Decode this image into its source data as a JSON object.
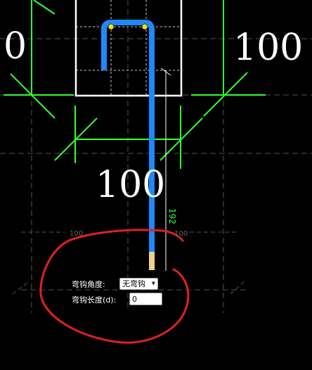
{
  "dimensions": {
    "left_value": "0",
    "right_value": "100",
    "bottom_value": "100",
    "small_left": "100",
    "small_right": "100",
    "bar_length": "192"
  },
  "hook_panel": {
    "angle_label": "弯钩角度:",
    "angle_value": "无弯钩",
    "length_label": "弯钩长度(d):",
    "length_value": "0"
  },
  "colors": {
    "background": "#000000",
    "rebar": "#1e88ff",
    "dimension": "#33ff33",
    "outline": "#ffffff",
    "annotation": "#e02020",
    "bar_tip": "#f0d090",
    "grid": "#555555"
  }
}
